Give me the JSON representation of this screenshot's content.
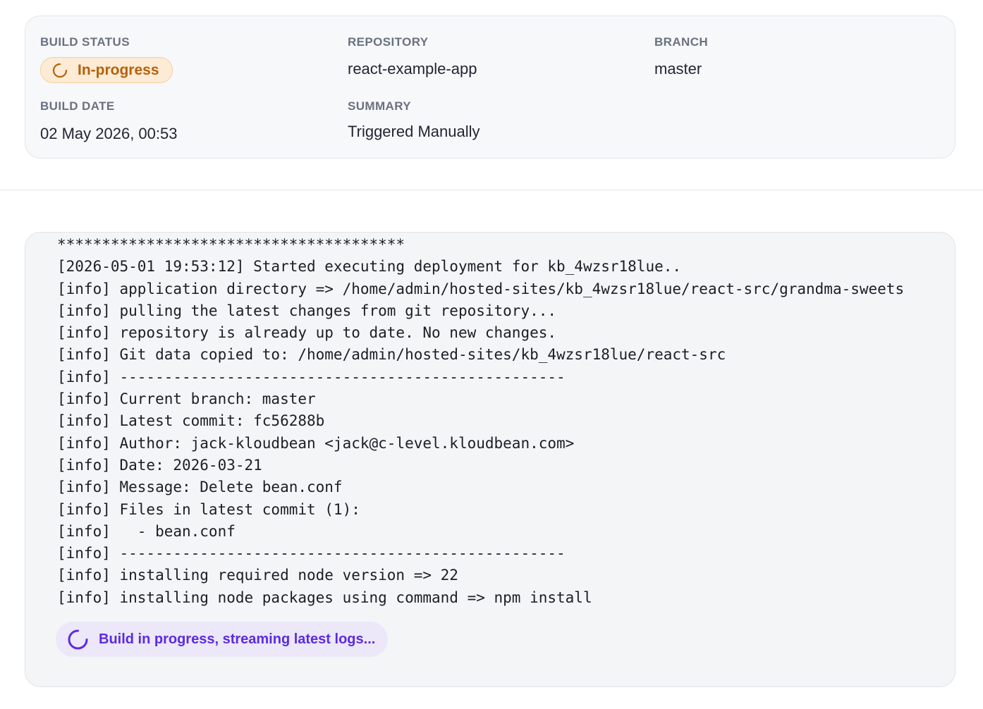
{
  "build": {
    "status_label": "Build Status",
    "status_value": "In-progress",
    "repository_label": "Repository",
    "repository_value": "react-example-app",
    "branch_label": "Branch",
    "branch_value": "master",
    "date_label": "Build Date",
    "date_value": "02 May 2026, 00:53",
    "summary_label": "Summary",
    "summary_value": "Triggered Manually"
  },
  "icons": {
    "status": "spinner-icon",
    "stream": "spinner-icon"
  },
  "colors": {
    "status_text": "#b4620a",
    "status_bg": "#fdebd5",
    "stream_text": "#5b2be0",
    "stream_bg": "#ece7f9"
  },
  "logs": {
    "lines": [
      "***************************************",
      "[2026-05-01 19:53:12] Started executing deployment for kb_4wzsr18lue..",
      "[info] application directory => /home/admin/hosted-sites/kb_4wzsr18lue/react-src/grandma-sweets",
      "[info] pulling the latest changes from git repository...",
      "[info] repository is already up to date. No new changes.",
      "[info] Git data copied to: /home/admin/hosted-sites/kb_4wzsr18lue/react-src",
      "[info] --------------------------------------------------",
      "[info] Current branch: master",
      "[info] Latest commit: fc56288b",
      "[info] Author: jack-kloudbean <jack@c-level.kloudbean.com>",
      "[info] Date: 2026-03-21",
      "[info] Message: Delete bean.conf",
      "[info] Files in latest commit (1):",
      "[info]   - bean.conf",
      "[info] --------------------------------------------------",
      "[info] installing required node version => 22",
      "[info] installing node packages using command => npm install"
    ],
    "streaming_message": "Build in progress, streaming latest logs..."
  }
}
